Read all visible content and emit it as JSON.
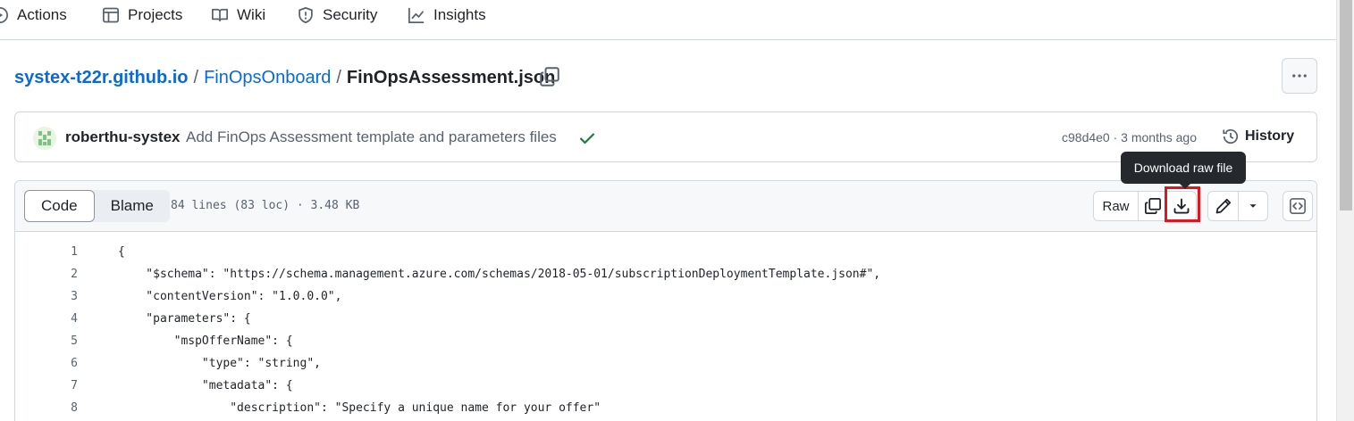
{
  "nav": {
    "items": [
      {
        "label": "Actions",
        "icon": "play-icon"
      },
      {
        "label": "Projects",
        "icon": "table-icon"
      },
      {
        "label": "Wiki",
        "icon": "book-icon"
      },
      {
        "label": "Security",
        "icon": "shield-icon"
      },
      {
        "label": "Insights",
        "icon": "graph-icon"
      }
    ]
  },
  "breadcrumb": {
    "repo": "systex-t22r.github.io",
    "folder": "FinOpsOnboard",
    "separator": "/",
    "file": "FinOpsAssessment.json"
  },
  "commit": {
    "author": "roberthu-systex",
    "message": "Add FinOps Assessment template and parameters files",
    "meta": "c98d4e0 · 3 months ago",
    "history_label": "History"
  },
  "tooltip": {
    "text": "Download raw file"
  },
  "file_header": {
    "tabs": [
      "Code",
      "Blame"
    ],
    "active_tab": "Code",
    "info": "84 lines (83 loc) · 3.48 KB",
    "raw_label": "Raw"
  },
  "code_lines": [
    {
      "num": "1",
      "text": "{"
    },
    {
      "num": "2",
      "text": "    \"$schema\": \"https://schema.management.azure.com/schemas/2018-05-01/subscriptionDeploymentTemplate.json#\","
    },
    {
      "num": "3",
      "text": "    \"contentVersion\": \"1.0.0.0\","
    },
    {
      "num": "4",
      "text": "    \"parameters\": {"
    },
    {
      "num": "5",
      "text": "        \"mspOfferName\": {"
    },
    {
      "num": "6",
      "text": "            \"type\": \"string\","
    },
    {
      "num": "7",
      "text": "            \"metadata\": {"
    },
    {
      "num": "8",
      "text": "                \"description\": \"Specify a unique name for your offer\""
    }
  ],
  "colors": {
    "link": "#0969da",
    "highlight": "#e0161f",
    "success": "#1a7f37",
    "tooltip_bg": "#25292e"
  }
}
